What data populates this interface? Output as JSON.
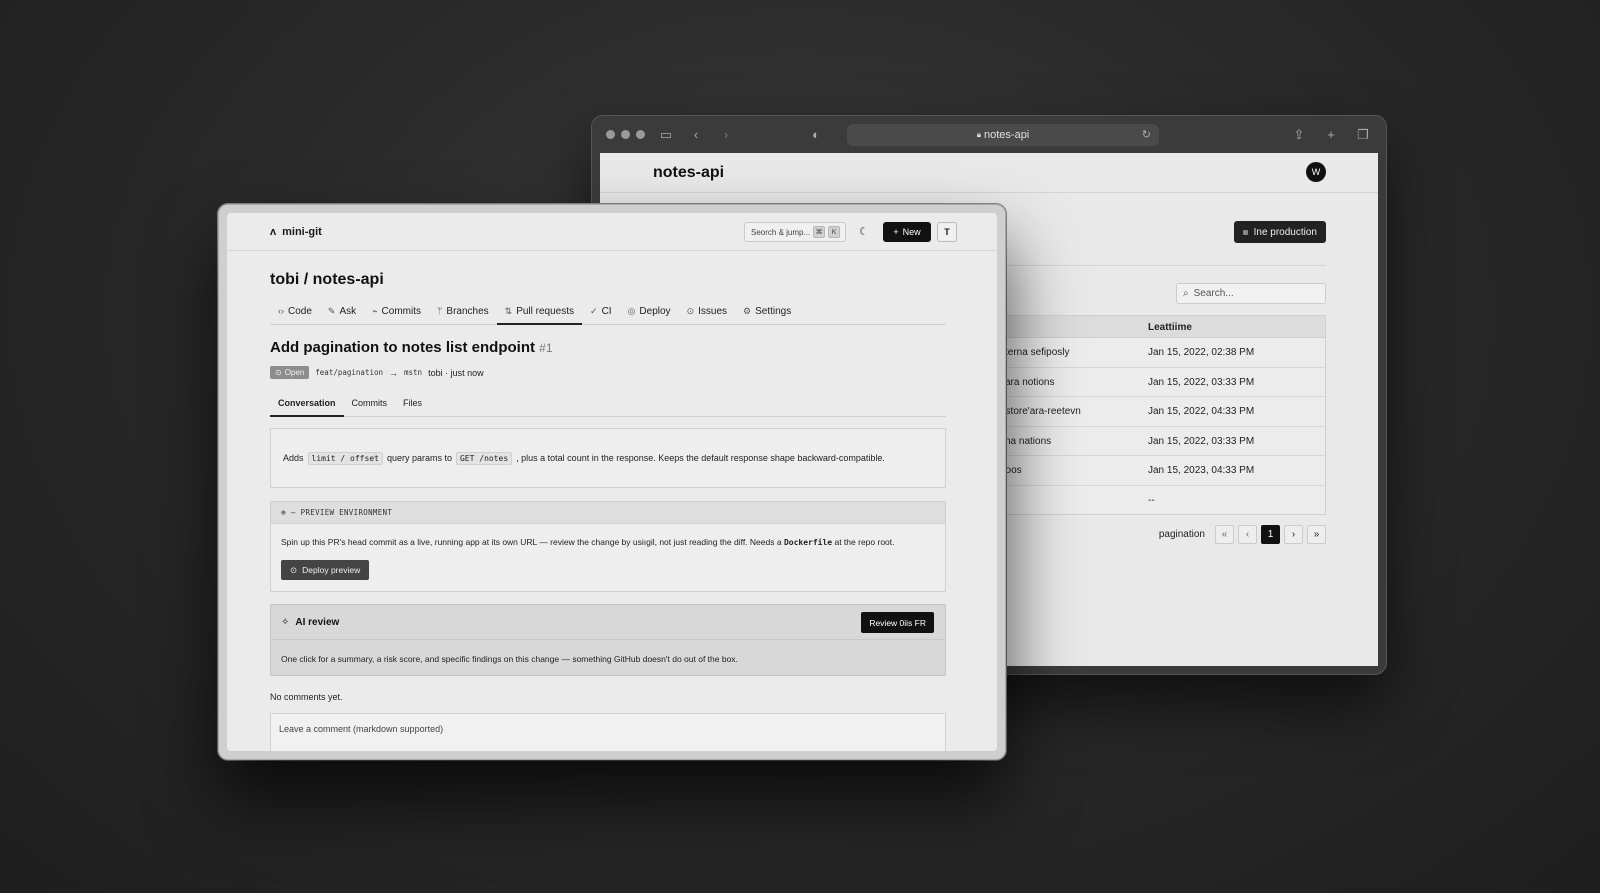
{
  "back_browser": {
    "url": "notes-api",
    "page_title": "notes-api",
    "avatar": "W",
    "production_button": "Ine production",
    "search_placeholder": "Search...",
    "table": {
      "column": "Leattiime",
      "rows": [
        {
          "name": "sterna sefiposly",
          "time": "Jan 15, 2022, 02:38 PM"
        },
        {
          "name": "cara notions",
          "time": "Jan 15, 2022, 03:33 PM"
        },
        {
          "name": "ostore'ara-reetevn",
          "time": "Jan 15, 2022, 04:33 PM"
        },
        {
          "name": "sna nations",
          "time": "Jan 15, 2022, 03:33 PM"
        },
        {
          "name": "boos",
          "time": "Jan 15, 2023, 04:33 PM"
        },
        {
          "name": "",
          "time": "--"
        }
      ]
    },
    "pagination": {
      "label": "pagination",
      "current": "1"
    }
  },
  "front": {
    "brand": "mini-git",
    "search_jump": "Seorch & jump...",
    "kbd1": "⌘",
    "kbd2": "K",
    "new_button": "New",
    "t_button": "T",
    "repo_title": "tobi / notes-api",
    "tabs": [
      {
        "icon": "‹›",
        "label": "Code"
      },
      {
        "icon": "✎",
        "label": "Ask"
      },
      {
        "icon": "⌁",
        "label": "Commits"
      },
      {
        "icon": "ᛘ",
        "label": "Branches"
      },
      {
        "icon": "⇅",
        "label": "Pull requests"
      },
      {
        "icon": "✓",
        "label": "CI"
      },
      {
        "icon": "◎",
        "label": "Deploy"
      },
      {
        "icon": "⊙",
        "label": "Issues"
      },
      {
        "icon": "⚙",
        "label": "Settings"
      }
    ],
    "pr": {
      "title": "Add pagination to notes list endpoint",
      "number": "#1",
      "status": "Open",
      "branch_from": "feat/pagination",
      "arrow": "→",
      "branch_to": "mstn",
      "author_time": "tobi · just now"
    },
    "subtabs": [
      "Conversation",
      "Commits",
      "Files"
    ],
    "description": {
      "pre": "Adds",
      "code1": "limit / offset",
      "mid": "query params to",
      "code2": "GET /notes",
      "post": ", plus a total count in the response. Keeps the default response shape backward-compatible."
    },
    "preview": {
      "heading": "PREVIEW ENVIRONMENT",
      "text_pre": "Spin up this PR's head commit as a live, running app at its own URL — review the change by usiıgil, not just reading the diff. Needs a",
      "text_code": "Dockerfile",
      "text_post": "at the repo root.",
      "button": "Deploy preview"
    },
    "ai_review": {
      "title": "AI review",
      "button": "Review 0iis FR",
      "text": "One click for a summary, a risk score, and specific findings on this change — something GitHub doesn't do out of the box."
    },
    "no_comments": "No comments yet.",
    "comment_placeholder": "Leave a comment (markdown supported)"
  }
}
